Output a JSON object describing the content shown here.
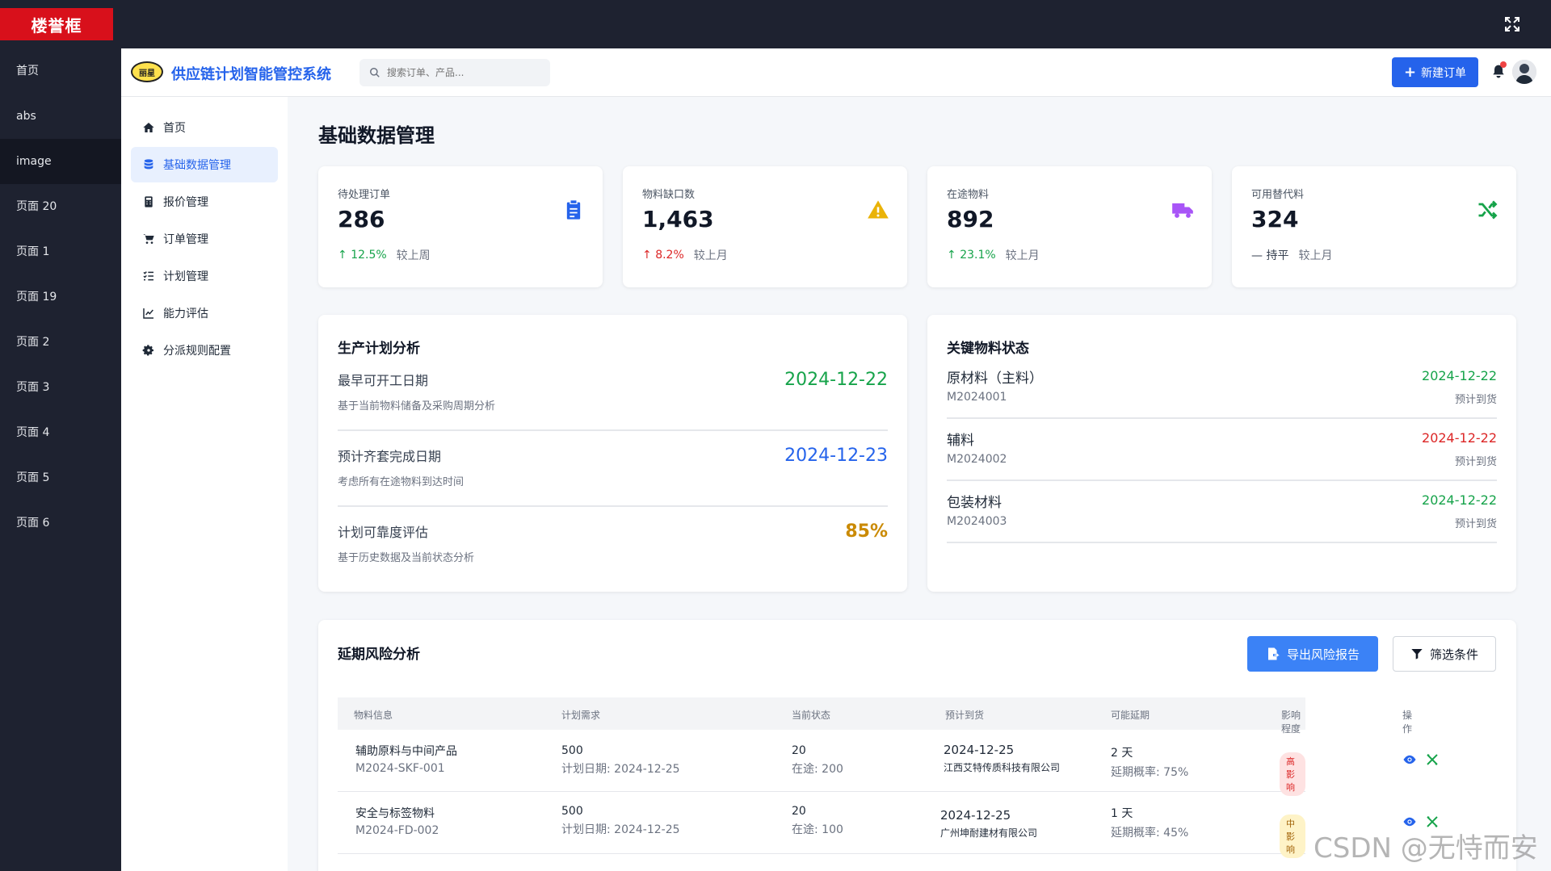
{
  "brand": {
    "logo_text": "楼誉框"
  },
  "outer_nav": [
    {
      "label": "首页"
    },
    {
      "label": "abs"
    },
    {
      "label": "image"
    },
    {
      "label": "页面 20"
    },
    {
      "label": "页面 1"
    },
    {
      "label": "页面 19"
    },
    {
      "label": "页面 2"
    },
    {
      "label": "页面 3"
    },
    {
      "label": "页面 4"
    },
    {
      "label": "页面 5"
    },
    {
      "label": "页面 6"
    }
  ],
  "header": {
    "logo_text": "丽星",
    "title": "供应链计划智能管控系统",
    "search_placeholder": "搜索订单、产品...",
    "new_order_label": "新建订单"
  },
  "side_nav": [
    {
      "label": "首页",
      "icon": "home-icon"
    },
    {
      "label": "基础数据管理",
      "icon": "database-icon"
    },
    {
      "label": "报价管理",
      "icon": "calculator-icon"
    },
    {
      "label": "订单管理",
      "icon": "cart-icon"
    },
    {
      "label": "计划管理",
      "icon": "list-check-icon"
    },
    {
      "label": "能力评估",
      "icon": "chart-line-icon"
    },
    {
      "label": "分派规则配置",
      "icon": "gear-icon"
    }
  ],
  "page_title": "基础数据管理",
  "stats": [
    {
      "label": "待处理订单",
      "value": "286",
      "change": "12.5%",
      "compare": "较上周",
      "icon": "clipboard-icon",
      "color": "#2563eb"
    },
    {
      "label": "物料缺口数",
      "value": "1,463",
      "change": "8.2%",
      "compare": "较上月",
      "icon": "warning-icon",
      "color": "#eab308"
    },
    {
      "label": "在途物料",
      "value": "892",
      "change": "23.1%",
      "compare": "较上月",
      "icon": "truck-icon",
      "color": "#a855f7"
    },
    {
      "label": "可用替代料",
      "value": "324",
      "change": "持平",
      "compare": "较上月",
      "icon": "shuffle-icon",
      "color": "#16a34a"
    }
  ],
  "production": {
    "title": "生产计划分析",
    "rows": [
      {
        "label": "最早可开工日期",
        "sub": "基于当前物料储备及采购周期分析",
        "value": "2024-12-22",
        "color": "#16a34a"
      },
      {
        "label": "预计齐套完成日期",
        "sub": "考虑所有在途物料到达时间",
        "value": "2024-12-23",
        "color": "#2563eb"
      },
      {
        "label": "计划可靠度评估",
        "sub": "基于历史数据及当前状态分析",
        "value": "85%",
        "color": "#ca8a04"
      }
    ]
  },
  "materials": {
    "title": "关键物料状态",
    "rows": [
      {
        "name": "原材料（主料）",
        "code": "M2024001",
        "date": "2024-12-22",
        "status": "预计到货",
        "color": "#16a34a"
      },
      {
        "name": "辅料",
        "code": "M2024002",
        "date": "2024-12-22",
        "status": "预计到货",
        "color": "#dc2626"
      },
      {
        "name": "包装材料",
        "code": "M2024003",
        "date": "2024-12-22",
        "status": "预计到货",
        "color": "#16a34a"
      }
    ]
  },
  "risk": {
    "title": "延期风险分析",
    "export_label": "导出风险报告",
    "filter_label": "筛选条件",
    "columns": [
      "物料信息",
      "计划需求",
      "当前状态",
      "预计到货",
      "可能延期",
      "影响程度",
      "操作"
    ],
    "rows": [
      {
        "name": "辅助原料与中间产品",
        "code": "M2024-SKF-001",
        "qty": "500",
        "plan_label": "计划日期:",
        "plan_date": "2024-12-25",
        "status_qty": "20",
        "transit": "在途: 200",
        "eta": "2024-12-25",
        "supplier": "江西艾特传质科技有限公司",
        "delay": "2 天",
        "prob": "延期概率: 75%",
        "impact": "高影响",
        "impact_bg": "#fee2e2",
        "impact_color": "#dc2626"
      },
      {
        "name": "安全与标签物料",
        "code": "M2024-FD-002",
        "qty": "500",
        "plan_label": "计划日期:",
        "plan_date": "2024-12-25",
        "status_qty": "20",
        "transit": "在途: 100",
        "eta": "2024-12-25",
        "supplier": "广州坤耐建材有限公司",
        "delay": "1 天",
        "prob": "延期概率: 45%",
        "impact": "中影响",
        "impact_bg": "#fef3c7",
        "impact_color": "#a16207"
      }
    ]
  },
  "watermark": "CSDN @无恃而安"
}
